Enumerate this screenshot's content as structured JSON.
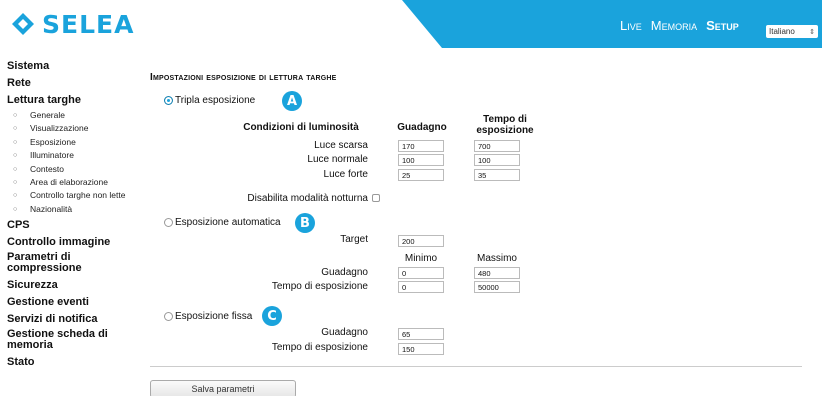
{
  "header": {
    "logo_text": "SELEA",
    "nav": [
      {
        "label": "Live",
        "active": false
      },
      {
        "label": "Memoria",
        "active": false
      },
      {
        "label": "Setup",
        "active": true
      }
    ],
    "language": "Italiano",
    "accent_color": "#1aa3dc"
  },
  "sidebar": {
    "items": [
      {
        "label": "Sistema",
        "type": "main"
      },
      {
        "label": "Rete",
        "type": "main"
      },
      {
        "label": "Lettura targhe",
        "type": "main"
      },
      {
        "label": "Generale",
        "type": "sub"
      },
      {
        "label": "Visualizzazione",
        "type": "sub"
      },
      {
        "label": "Esposizione",
        "type": "sub"
      },
      {
        "label": "Illuminatore",
        "type": "sub"
      },
      {
        "label": "Contesto",
        "type": "sub"
      },
      {
        "label": "Area di elaborazione",
        "type": "sub"
      },
      {
        "label": "Controllo targhe non lette",
        "type": "sub"
      },
      {
        "label": "Nazionalità",
        "type": "sub"
      },
      {
        "label": "CPS",
        "type": "main"
      },
      {
        "label": "Controllo immagine",
        "type": "main"
      },
      {
        "label": "Parametri di compressione",
        "type": "main"
      },
      {
        "label": "Sicurezza",
        "type": "main"
      },
      {
        "label": "Gestione eventi",
        "type": "main"
      },
      {
        "label": "Servizi di notifica",
        "type": "main"
      },
      {
        "label": "Gestione scheda di memoria",
        "type": "main"
      },
      {
        "label": "Stato",
        "type": "main"
      }
    ]
  },
  "main": {
    "title": "Impostazioni esposizione di lettura targhe",
    "triple": {
      "label": "Tripla esposizione",
      "selected": true,
      "badge": "A",
      "col_condition": "Condizioni di luminosità",
      "col_gain": "Guadagno",
      "col_exposure": "Tempo di esposizione",
      "rows": [
        {
          "label": "Luce scarsa",
          "gain": "170",
          "exposure": "700"
        },
        {
          "label": "Luce normale",
          "gain": "100",
          "exposure": "100"
        },
        {
          "label": "Luce forte",
          "gain": "25",
          "exposure": "35"
        }
      ],
      "night_label": "Disabilita modalità notturna",
      "night_checked": false
    },
    "auto": {
      "label": "Esposizione automatica",
      "selected": false,
      "badge": "B",
      "target_label": "Target",
      "target_value": "200",
      "col_min": "Minimo",
      "col_max": "Massimo",
      "gain_label": "Guadagno",
      "gain_min": "0",
      "gain_max": "480",
      "exp_label": "Tempo di esposizione",
      "exp_min": "0",
      "exp_max": "50000"
    },
    "fixed": {
      "label": "Esposizione fissa",
      "selected": false,
      "badge": "C",
      "gain_label": "Guadagno",
      "gain_value": "65",
      "exp_label": "Tempo di esposizione",
      "exp_value": "150"
    },
    "save_label": "Salva parametri"
  }
}
